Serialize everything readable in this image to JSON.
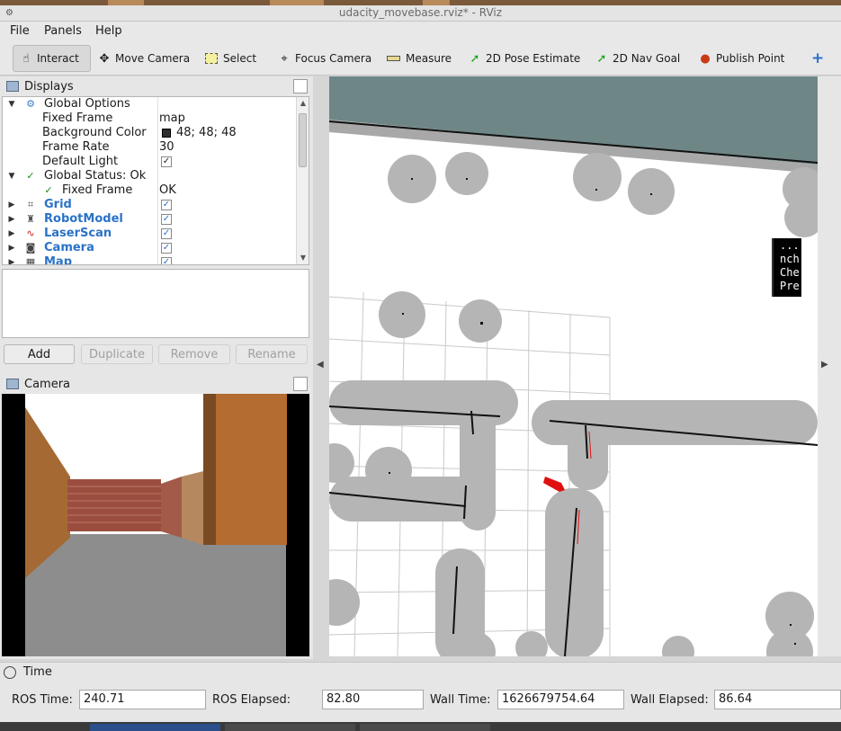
{
  "window": {
    "title": "udacity_movebase.rviz* - RViz"
  },
  "menu": {
    "file": "File",
    "panels": "Panels",
    "help": "Help"
  },
  "toolbar": {
    "interact": "Interact",
    "move_camera": "Move Camera",
    "select": "Select",
    "focus_camera": "Focus Camera",
    "measure": "Measure",
    "pose_estimate": "2D Pose Estimate",
    "nav_goal": "2D Nav Goal",
    "publish_point": "Publish Point",
    "add_tool": "+"
  },
  "displays": {
    "title": "Displays",
    "global_options": "Global Options",
    "fixed_frame_label": "Fixed Frame",
    "fixed_frame_value": "map",
    "bg_color_label": "Background Color",
    "bg_color_value": "48; 48; 48",
    "frame_rate_label": "Frame Rate",
    "frame_rate_value": "30",
    "default_light_label": "Default Light",
    "global_status": "Global Status: Ok",
    "fixed_frame_status_label": "Fixed Frame",
    "fixed_frame_status_value": "OK",
    "plugins": [
      "Grid",
      "RobotModel",
      "LaserScan",
      "Camera",
      "Map"
    ],
    "checkmark": "✓",
    "buttons": {
      "add": "Add",
      "duplicate": "Duplicate",
      "remove": "Remove",
      "rename": "Rename"
    }
  },
  "camera_panel": {
    "title": "Camera"
  },
  "viewport_overlay": [
    "...",
    "nch",
    "Che",
    "Pre"
  ],
  "time_panel": {
    "title": "Time",
    "ros_time_label": "ROS Time:",
    "ros_time_value": "240.71",
    "ros_elapsed_label": "ROS Elapsed:",
    "ros_elapsed_value": "82.80",
    "wall_time_label": "Wall Time:",
    "wall_time_value": "1626679754.64",
    "wall_elapsed_label": "Wall Elapsed:",
    "wall_elapsed_value": "86.64"
  },
  "colors": {
    "accent": "#2a72c8",
    "status_ok": "#1f8a1f",
    "robot": "#e01010"
  }
}
